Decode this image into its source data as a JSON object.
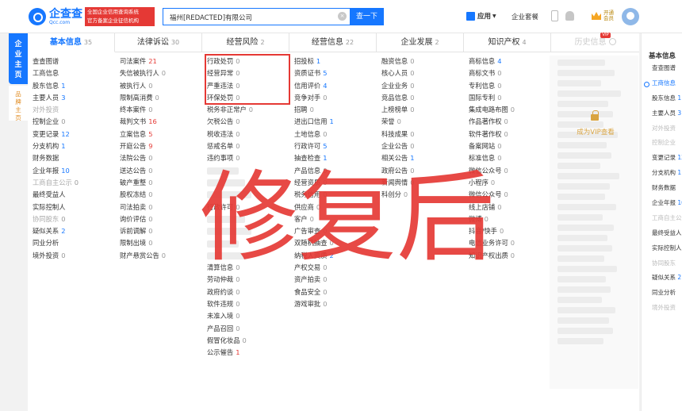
{
  "header": {
    "logo_cn": "企查查",
    "logo_en": "Qcc.com",
    "badge_line1": "全国企业信用查询系统",
    "badge_line2": "官方备案企业征信机构",
    "search_value": "福州[REDACTED]有限公司",
    "search_button": "查一下",
    "apps_label": "应用",
    "enterprise_pkg": "企业套餐",
    "vip_line1": "开通",
    "vip_line2": "会员"
  },
  "left_nav": {
    "main_label": "企业主页",
    "brand_label": "品牌主页"
  },
  "tabs": [
    {
      "label": "基本信息",
      "count": "35"
    },
    {
      "label": "法律诉讼",
      "count": "30"
    },
    {
      "label": "经营风险",
      "count": "2"
    },
    {
      "label": "经营信息",
      "count": "22"
    },
    {
      "label": "企业发展",
      "count": "2"
    },
    {
      "label": "知识产权",
      "count": "4"
    },
    {
      "label": "历史信息",
      "count": "",
      "tag": "VIP"
    }
  ],
  "columns": [
    [
      {
        "t": "查查图谱"
      },
      {
        "t": "工商信息"
      },
      {
        "t": "股东信息",
        "n": "1",
        "c": "blue"
      },
      {
        "t": "主要人员",
        "n": "3",
        "c": "blue"
      },
      {
        "t": "对外投资",
        "d": true
      },
      {
        "t": "控制企业",
        "n": "0"
      },
      {
        "t": "变更记录",
        "n": "12",
        "c": "blue"
      },
      {
        "t": "分支机构",
        "n": "1",
        "c": "blue"
      },
      {
        "t": "财务数据"
      },
      {
        "t": "企业年报",
        "n": "10",
        "c": "blue"
      },
      {
        "t": "工商自主公示",
        "n": "0",
        "d": true
      },
      {
        "t": "最终受益人"
      },
      {
        "t": "实际控制人"
      },
      {
        "t": "协同股东",
        "n": "0",
        "d": true
      },
      {
        "t": "疑似关系",
        "n": "2",
        "c": "blue"
      },
      {
        "t": "同业分析"
      },
      {
        "t": "境外投资",
        "n": "0"
      }
    ],
    [
      {
        "t": "司法案件",
        "n": "21",
        "c": "red"
      },
      {
        "t": "失信被执行人",
        "n": "0"
      },
      {
        "t": "被执行人",
        "n": "0"
      },
      {
        "t": "限制高消费",
        "n": "0"
      },
      {
        "t": "终本案件",
        "n": "0"
      },
      {
        "t": "裁判文书",
        "n": "16",
        "c": "red"
      },
      {
        "t": "立案信息",
        "n": "5",
        "c": "red"
      },
      {
        "t": "开庭公告",
        "n": "9",
        "c": "red"
      },
      {
        "t": "法院公告",
        "n": "0"
      },
      {
        "t": "送达公告",
        "n": "0"
      },
      {
        "t": "破产重整",
        "n": "0"
      },
      {
        "t": "股权冻结",
        "n": "0"
      },
      {
        "t": "司法拍卖",
        "n": "0"
      },
      {
        "t": "询价评估",
        "n": "0"
      },
      {
        "t": "诉前调解",
        "n": "0"
      },
      {
        "t": "限制出境",
        "n": "0"
      },
      {
        "t": "财产悬赏公告",
        "n": "0"
      }
    ],
    [
      {
        "t": "行政处罚",
        "n": "0"
      },
      {
        "t": "经营异常",
        "n": "0"
      },
      {
        "t": "严重违法",
        "n": "0"
      },
      {
        "t": "环保处罚",
        "n": "0"
      },
      {
        "t": "税务非正常户",
        "n": "0"
      },
      {
        "t": "欠税公告",
        "n": "0"
      },
      {
        "t": "税收违法",
        "n": "0"
      },
      {
        "t": "惩戒名单",
        "n": "0"
      },
      {
        "t": "违约事项",
        "n": "0"
      },
      {
        "t": "",
        "b": 40
      },
      {
        "t": "",
        "b": 40
      },
      {
        "t": "",
        "b": 40
      },
      {
        "t": "行政许可",
        "n": "0"
      },
      {
        "t": "",
        "b": 40
      },
      {
        "t": "",
        "b": 40
      },
      {
        "t": "",
        "b": 40
      },
      {
        "t": "",
        "b": 40
      },
      {
        "t": "清算信息",
        "n": "0"
      },
      {
        "t": "劳动仲裁",
        "n": "0"
      },
      {
        "t": "政府约谈",
        "n": "0"
      },
      {
        "t": "软件违规",
        "n": "0"
      },
      {
        "t": "未准入境",
        "n": "0"
      },
      {
        "t": "产品召回",
        "n": "0"
      },
      {
        "t": "假冒化妆品",
        "n": "0"
      },
      {
        "t": "公示催告",
        "n": "1",
        "c": "red"
      }
    ],
    [
      {
        "t": "招投标",
        "n": "1",
        "c": "blue"
      },
      {
        "t": "资质证书",
        "n": "5",
        "c": "blue"
      },
      {
        "t": "信用评价",
        "n": "4",
        "c": "blue"
      },
      {
        "t": "竞争对手",
        "n": "0"
      },
      {
        "t": "招聘",
        "n": "0"
      },
      {
        "t": "进出口信用",
        "n": "1",
        "c": "blue"
      },
      {
        "t": "土地信息",
        "n": "0"
      },
      {
        "t": "行政许可",
        "n": "5",
        "c": "blue"
      },
      {
        "t": "抽查检查",
        "n": "1",
        "c": "blue"
      },
      {
        "t": "产品信息",
        "n": "0"
      },
      {
        "t": "经营资质",
        "n": "0"
      },
      {
        "t": "税务信用",
        "n": "0"
      },
      {
        "t": "供应商",
        "n": "0"
      },
      {
        "t": "客户",
        "n": "0"
      },
      {
        "t": "广告审查",
        "n": "0"
      },
      {
        "t": "双随机抽查",
        "n": "0"
      },
      {
        "t": "纳税人资质",
        "n": "2",
        "c": "blue"
      },
      {
        "t": "产权交易",
        "n": "0"
      },
      {
        "t": "资产拍卖",
        "n": "0"
      },
      {
        "t": "食品安全",
        "n": "0"
      },
      {
        "t": "游戏审批",
        "n": "0"
      }
    ],
    [
      {
        "t": "融资信息",
        "n": "0"
      },
      {
        "t": "核心人员",
        "n": "0"
      },
      {
        "t": "企业业务",
        "n": "0"
      },
      {
        "t": "竞品信息",
        "n": "0"
      },
      {
        "t": "上榜榜单",
        "n": "0"
      },
      {
        "t": "荣誉",
        "n": "0"
      },
      {
        "t": "科技成果",
        "n": "0"
      },
      {
        "t": "企业公告",
        "n": "0"
      },
      {
        "t": "相关公告",
        "n": "1",
        "c": "blue"
      },
      {
        "t": "政府公告",
        "n": "0"
      },
      {
        "t": "新闻舆情",
        "n": "0"
      },
      {
        "t": "科创分",
        "n": "0"
      }
    ],
    [
      {
        "t": "商标信息",
        "n": "4",
        "c": "blue"
      },
      {
        "t": "商标文书",
        "n": "0"
      },
      {
        "t": "专利信息",
        "n": "0"
      },
      {
        "t": "国际专利",
        "n": "0"
      },
      {
        "t": "集成电路布图",
        "n": "0"
      },
      {
        "t": "作品著作权",
        "n": "0"
      },
      {
        "t": "软件著作权",
        "n": "0"
      },
      {
        "t": "备案网站",
        "n": "0"
      },
      {
        "t": "标准信息",
        "n": "0"
      },
      {
        "t": "微信公众号",
        "n": "0"
      },
      {
        "t": "小程序",
        "n": "0"
      },
      {
        "t": "微信公众号",
        "n": "0"
      },
      {
        "t": "线上店铺",
        "n": "0"
      },
      {
        "t": "微博",
        "n": "0"
      },
      {
        "t": "抖音/快手",
        "n": "0"
      },
      {
        "t": "电信业务许可",
        "n": "0"
      },
      {
        "t": "知识产权出质",
        "n": "0"
      }
    ]
  ],
  "history": {
    "vip_view": "成为VIP查看"
  },
  "right_sidebar": {
    "title": "基本信息",
    "items": [
      {
        "t": "查查图谱"
      },
      {
        "t": "工商信息",
        "active": true
      },
      {
        "t": "股东信息",
        "n": "1"
      },
      {
        "t": "主要人员",
        "n": "3"
      },
      {
        "t": "对外投资",
        "d": true
      },
      {
        "t": "控制企业",
        "d": true
      },
      {
        "t": "变更记录",
        "n": "12"
      },
      {
        "t": "分支机构",
        "n": "1"
      },
      {
        "t": "财务数据"
      },
      {
        "t": "企业年报",
        "n": "10"
      },
      {
        "t": "工商自主公示",
        "d": true
      },
      {
        "t": "最终受益人"
      },
      {
        "t": "实际控制人"
      },
      {
        "t": "协同股东",
        "d": true
      },
      {
        "t": "疑似关系",
        "n": "2"
      },
      {
        "t": "同业分析"
      },
      {
        "t": "境外投资",
        "d": true
      }
    ]
  },
  "watermark": {
    "text": "修复后",
    "color": "#e53935"
  }
}
